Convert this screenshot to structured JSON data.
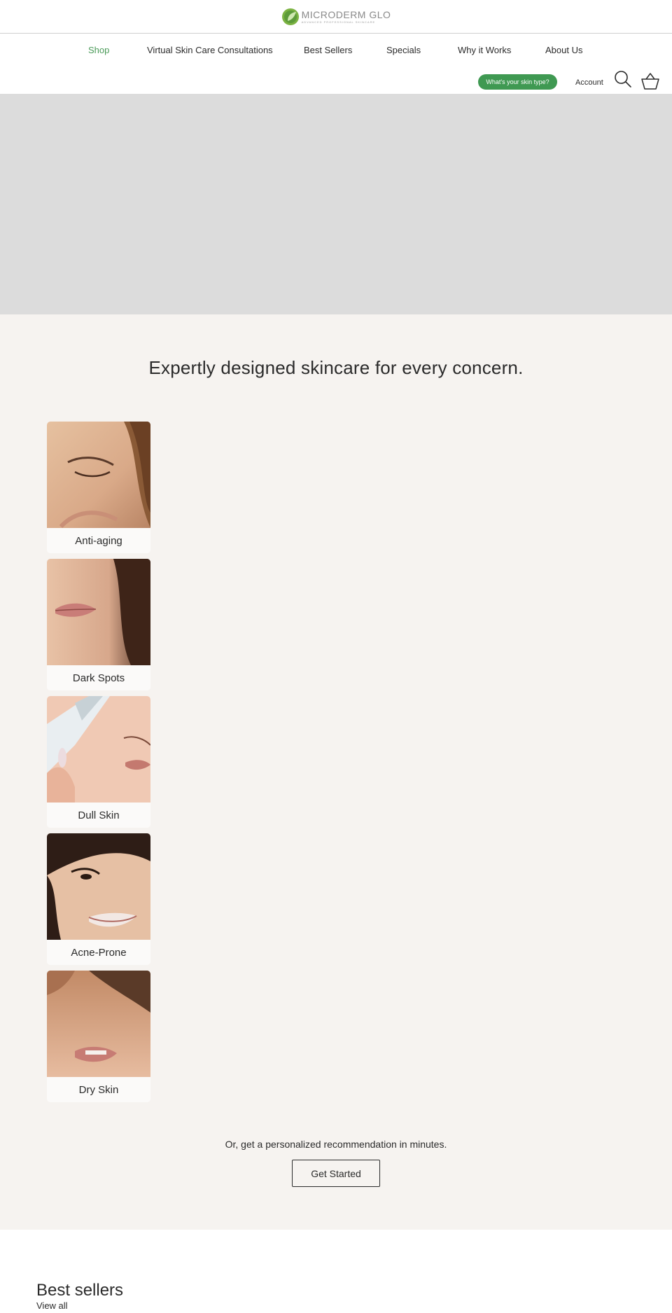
{
  "brand": {
    "name": "MICRODERM GLO",
    "tagline": "ADVANCED PROFESSIONAL SKINCARE",
    "accent_color": "#3f9952"
  },
  "nav": {
    "items": [
      {
        "label": "Shop",
        "active": true
      },
      {
        "label": "Virtual Skin Care Consultations",
        "active": false
      },
      {
        "label": "Best Sellers",
        "active": false
      },
      {
        "label": "Specials",
        "active": false
      },
      {
        "label": "Why it Works",
        "active": false
      },
      {
        "label": "About Us",
        "active": false
      }
    ]
  },
  "utility": {
    "skin_type_label": "What's your skin type?",
    "account_label": "Account",
    "search_icon": "search-icon",
    "cart_icon": "basket-icon"
  },
  "concerns": {
    "title": "Expertly designed skincare for every concern.",
    "items": [
      {
        "label": "Anti-aging"
      },
      {
        "label": "Dark Spots"
      },
      {
        "label": "Dull Skin"
      },
      {
        "label": "Acne-Prone"
      },
      {
        "label": "Dry Skin"
      }
    ],
    "reco_text": "Or, get a personalized recommendation in minutes.",
    "cta_label": "Get Started"
  },
  "best_sellers": {
    "title": "Best sellers",
    "view_all_label": "View all"
  }
}
